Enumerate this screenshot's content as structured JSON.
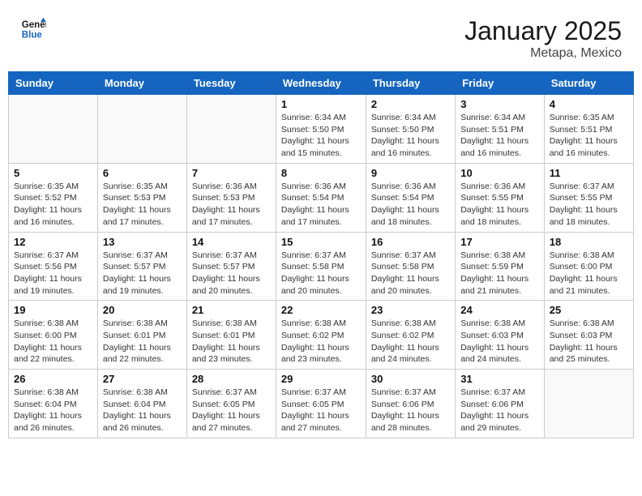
{
  "header": {
    "logo_line1": "General",
    "logo_line2": "Blue",
    "month": "January 2025",
    "location": "Metapa, Mexico"
  },
  "weekdays": [
    "Sunday",
    "Monday",
    "Tuesday",
    "Wednesday",
    "Thursday",
    "Friday",
    "Saturday"
  ],
  "weeks": [
    [
      {
        "day": "",
        "info": ""
      },
      {
        "day": "",
        "info": ""
      },
      {
        "day": "",
        "info": ""
      },
      {
        "day": "1",
        "info": "Sunrise: 6:34 AM\nSunset: 5:50 PM\nDaylight: 11 hours\nand 15 minutes."
      },
      {
        "day": "2",
        "info": "Sunrise: 6:34 AM\nSunset: 5:50 PM\nDaylight: 11 hours\nand 16 minutes."
      },
      {
        "day": "3",
        "info": "Sunrise: 6:34 AM\nSunset: 5:51 PM\nDaylight: 11 hours\nand 16 minutes."
      },
      {
        "day": "4",
        "info": "Sunrise: 6:35 AM\nSunset: 5:51 PM\nDaylight: 11 hours\nand 16 minutes."
      }
    ],
    [
      {
        "day": "5",
        "info": "Sunrise: 6:35 AM\nSunset: 5:52 PM\nDaylight: 11 hours\nand 16 minutes."
      },
      {
        "day": "6",
        "info": "Sunrise: 6:35 AM\nSunset: 5:53 PM\nDaylight: 11 hours\nand 17 minutes."
      },
      {
        "day": "7",
        "info": "Sunrise: 6:36 AM\nSunset: 5:53 PM\nDaylight: 11 hours\nand 17 minutes."
      },
      {
        "day": "8",
        "info": "Sunrise: 6:36 AM\nSunset: 5:54 PM\nDaylight: 11 hours\nand 17 minutes."
      },
      {
        "day": "9",
        "info": "Sunrise: 6:36 AM\nSunset: 5:54 PM\nDaylight: 11 hours\nand 18 minutes."
      },
      {
        "day": "10",
        "info": "Sunrise: 6:36 AM\nSunset: 5:55 PM\nDaylight: 11 hours\nand 18 minutes."
      },
      {
        "day": "11",
        "info": "Sunrise: 6:37 AM\nSunset: 5:55 PM\nDaylight: 11 hours\nand 18 minutes."
      }
    ],
    [
      {
        "day": "12",
        "info": "Sunrise: 6:37 AM\nSunset: 5:56 PM\nDaylight: 11 hours\nand 19 minutes."
      },
      {
        "day": "13",
        "info": "Sunrise: 6:37 AM\nSunset: 5:57 PM\nDaylight: 11 hours\nand 19 minutes."
      },
      {
        "day": "14",
        "info": "Sunrise: 6:37 AM\nSunset: 5:57 PM\nDaylight: 11 hours\nand 20 minutes."
      },
      {
        "day": "15",
        "info": "Sunrise: 6:37 AM\nSunset: 5:58 PM\nDaylight: 11 hours\nand 20 minutes."
      },
      {
        "day": "16",
        "info": "Sunrise: 6:37 AM\nSunset: 5:58 PM\nDaylight: 11 hours\nand 20 minutes."
      },
      {
        "day": "17",
        "info": "Sunrise: 6:38 AM\nSunset: 5:59 PM\nDaylight: 11 hours\nand 21 minutes."
      },
      {
        "day": "18",
        "info": "Sunrise: 6:38 AM\nSunset: 6:00 PM\nDaylight: 11 hours\nand 21 minutes."
      }
    ],
    [
      {
        "day": "19",
        "info": "Sunrise: 6:38 AM\nSunset: 6:00 PM\nDaylight: 11 hours\nand 22 minutes."
      },
      {
        "day": "20",
        "info": "Sunrise: 6:38 AM\nSunset: 6:01 PM\nDaylight: 11 hours\nand 22 minutes."
      },
      {
        "day": "21",
        "info": "Sunrise: 6:38 AM\nSunset: 6:01 PM\nDaylight: 11 hours\nand 23 minutes."
      },
      {
        "day": "22",
        "info": "Sunrise: 6:38 AM\nSunset: 6:02 PM\nDaylight: 11 hours\nand 23 minutes."
      },
      {
        "day": "23",
        "info": "Sunrise: 6:38 AM\nSunset: 6:02 PM\nDaylight: 11 hours\nand 24 minutes."
      },
      {
        "day": "24",
        "info": "Sunrise: 6:38 AM\nSunset: 6:03 PM\nDaylight: 11 hours\nand 24 minutes."
      },
      {
        "day": "25",
        "info": "Sunrise: 6:38 AM\nSunset: 6:03 PM\nDaylight: 11 hours\nand 25 minutes."
      }
    ],
    [
      {
        "day": "26",
        "info": "Sunrise: 6:38 AM\nSunset: 6:04 PM\nDaylight: 11 hours\nand 26 minutes."
      },
      {
        "day": "27",
        "info": "Sunrise: 6:38 AM\nSunset: 6:04 PM\nDaylight: 11 hours\nand 26 minutes."
      },
      {
        "day": "28",
        "info": "Sunrise: 6:37 AM\nSunset: 6:05 PM\nDaylight: 11 hours\nand 27 minutes."
      },
      {
        "day": "29",
        "info": "Sunrise: 6:37 AM\nSunset: 6:05 PM\nDaylight: 11 hours\nand 27 minutes."
      },
      {
        "day": "30",
        "info": "Sunrise: 6:37 AM\nSunset: 6:06 PM\nDaylight: 11 hours\nand 28 minutes."
      },
      {
        "day": "31",
        "info": "Sunrise: 6:37 AM\nSunset: 6:06 PM\nDaylight: 11 hours\nand 29 minutes."
      },
      {
        "day": "",
        "info": ""
      }
    ]
  ]
}
